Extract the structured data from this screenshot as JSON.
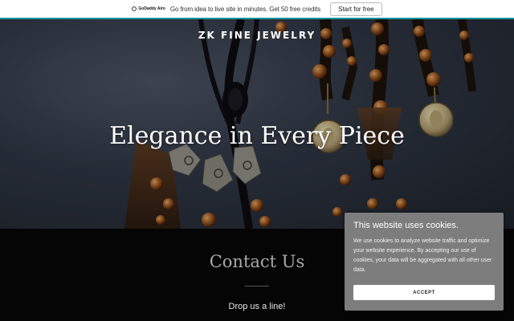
{
  "promo": {
    "logo_text": "GoDaddy Airo",
    "message": "Go from idea to live site in minutes. Get 50 free credits",
    "cta": "Start for free"
  },
  "header": {
    "brand": "ZK FINE JEWELRY"
  },
  "hero": {
    "title": "Elegance in Every Piece"
  },
  "contact": {
    "title": "Contact Us",
    "subtitle": "Drop us a line!"
  },
  "cookie": {
    "title": "This website uses cookies.",
    "body": "We use cookies to analyze website traffic and optimize your website experience. By accepting our use of cookies, your data will be aggregated with all other user data.",
    "accept": "ACCEPT"
  },
  "colors": {
    "promo_border": "#1a9aa0",
    "cookie_bg": "#7d7d7d",
    "page_bg": "#050505"
  }
}
